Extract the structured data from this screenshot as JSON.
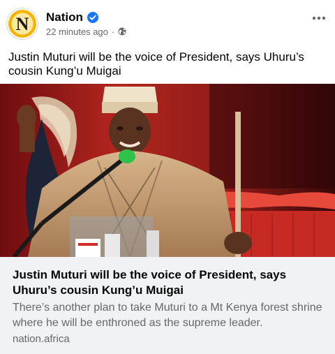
{
  "post": {
    "author": "Nation",
    "avatar_letter": "N",
    "timestamp": "22 minutes ago",
    "separator": "·",
    "privacy": "globe-icon",
    "text": "Justin Muturi will be the voice of President, says Uhuru’s cousin Kung’u Muigai"
  },
  "link_preview": {
    "title": "Justin Muturi will be the voice of President, says Uhuru’s cousin Kung’u Muigai",
    "description": "There’s another plan to take Muturi to a Mt Kenya forest shrine where he will be enthroned as the supreme leader.",
    "domain": "nation.africa"
  },
  "colors": {
    "verified": "#1877f2",
    "avatar_ring": "#f5b400",
    "avatar_letter": "#1a1a1a",
    "secondary_text": "#65676b",
    "card_bg": "#f0f2f5"
  }
}
